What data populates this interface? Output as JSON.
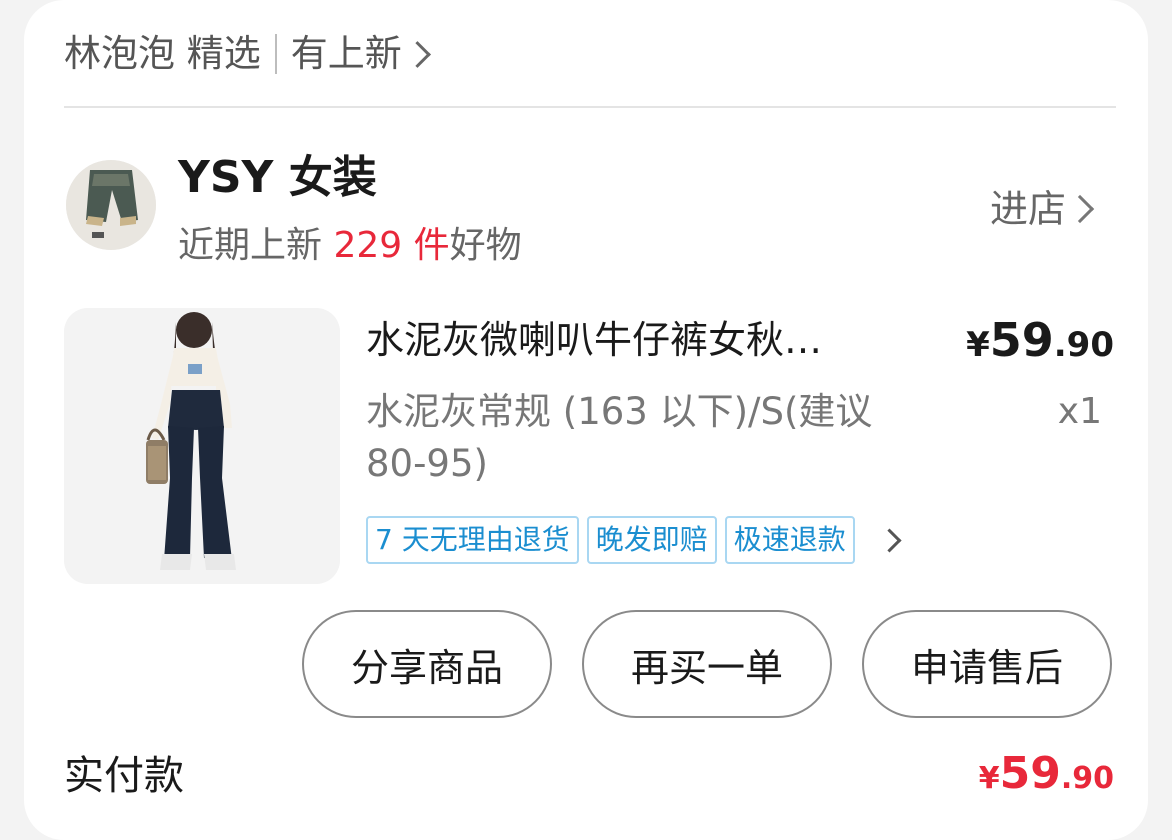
{
  "header": {
    "shop_name": "林泡泡 精选",
    "new_label": "有上新"
  },
  "store": {
    "name": "YSY 女装",
    "sub_prefix": "近期上新 ",
    "sub_count": "229 件",
    "sub_suffix": "好物",
    "enter_label": "进店"
  },
  "product": {
    "title": "水泥灰微喇叭牛仔裤女秋…",
    "spec": "水泥灰常规 (163 以下)/S(建议 80-95)",
    "price_symbol": "¥",
    "price_int": "59",
    "price_dec": ".90",
    "quantity": "x1",
    "tags": [
      "7 天无理由退货",
      "晚发即赔",
      "极速退款"
    ]
  },
  "actions": {
    "share": "分享商品",
    "rebuy": "再买一单",
    "after_sale": "申请售后"
  },
  "payment": {
    "label": "实付款",
    "symbol": "¥",
    "amount_int": "59",
    "amount_dec": ".90"
  },
  "colors": {
    "accent_red": "#e8283a",
    "tag_blue": "#1b8ed0"
  }
}
